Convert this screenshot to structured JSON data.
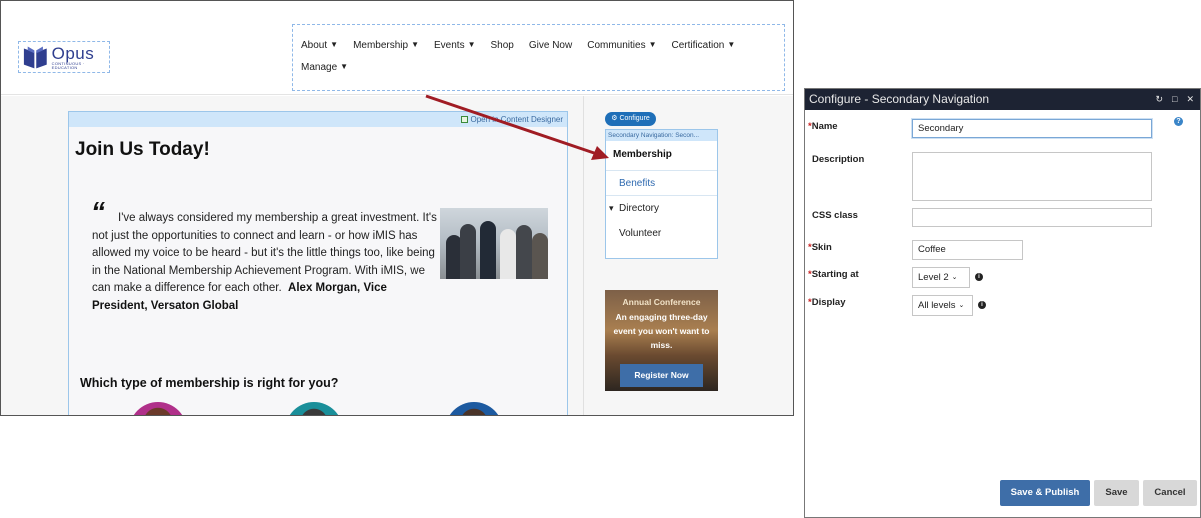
{
  "site": {
    "logo": {
      "name": "Opus",
      "sub": "CONTINUOUS · EDUCATION"
    },
    "nav": [
      {
        "label": "About",
        "dropdown": true
      },
      {
        "label": "Membership",
        "dropdown": true
      },
      {
        "label": "Events",
        "dropdown": true
      },
      {
        "label": "Shop",
        "dropdown": false
      },
      {
        "label": "Give Now",
        "dropdown": false
      },
      {
        "label": "Communities",
        "dropdown": true
      },
      {
        "label": "Certification",
        "dropdown": true
      },
      {
        "label": "Manage",
        "dropdown": true
      }
    ],
    "main": {
      "open_designer": "Open in Content Designer",
      "title": "Join Us Today!",
      "quote_mark": "“",
      "quote": "I've always considered my membership a great investment. It's not just the opportunities to connect and learn - or how iMIS has allowed my voice to be heard - but it's the little things too, like being in the National Membership Achievement Program. With iMIS, we can make a difference for each other.",
      "quote_author": "Alex Morgan, Vice President, Versaton Global",
      "subheading": "Which type of membership is right for you?"
    },
    "sidebar": {
      "configure": "Configure",
      "content_title": "Secondary Navigation: Secon...",
      "root": "Membership",
      "links": [
        {
          "label": "Benefits",
          "expander": ""
        },
        {
          "label": "Directory",
          "expander": "▾"
        },
        {
          "label": "Volunteer",
          "expander": ""
        }
      ],
      "ad": {
        "title": "Annual Conference",
        "text": "An engaging three-day event you won't want to miss.",
        "button": "Register Now"
      }
    }
  },
  "dialog": {
    "title": "Configure - Secondary Navigation",
    "controls": [
      "↻",
      "□",
      "✕"
    ],
    "fields": {
      "name": {
        "label": "Name",
        "required": "*",
        "value": "Secondary"
      },
      "description": {
        "label": "Description",
        "value": ""
      },
      "css_class": {
        "label": "CSS class",
        "value": ""
      },
      "skin": {
        "label": "Skin",
        "required": "*",
        "value": "Coffee"
      },
      "starting_at": {
        "label": "Starting at",
        "required": "*",
        "value": "Level 2"
      },
      "display": {
        "label": "Display",
        "required": "*",
        "value": "All levels"
      }
    },
    "buttons": {
      "save_publish": "Save & Publish",
      "save": "Save",
      "cancel": "Cancel"
    }
  },
  "colors": {
    "accent": "#3e6ea8",
    "arrow": "#a01c24",
    "titlebar": "#1d2333"
  }
}
